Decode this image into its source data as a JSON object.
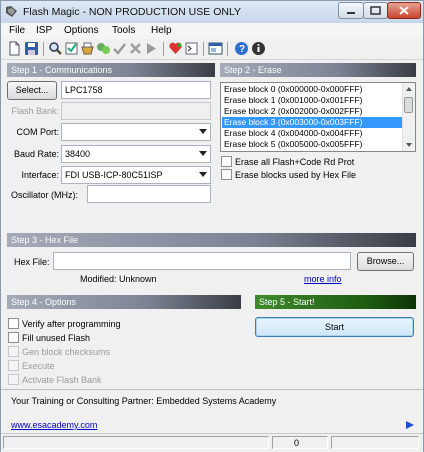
{
  "window": {
    "title": "Flash Magic - NON PRODUCTION USE ONLY"
  },
  "menu": [
    "File",
    "ISP",
    "Options",
    "Tools",
    "Help"
  ],
  "toolbar_icons": [
    "new-icon",
    "save-icon",
    "search-icon",
    "verify-icon",
    "program-icon",
    "check-icon",
    "erase-icon",
    "forward-icon",
    "heart-icon",
    "terminal-icon",
    "window-icon",
    "help-icon",
    "info-icon"
  ],
  "step1": {
    "header": "Step 1 - Communications",
    "select_label": "Select...",
    "device": "LPC1758",
    "flash_bank_label": "Flash Bank:",
    "com_port_label": "COM Port:",
    "com_port_value": "",
    "baud_rate_label": "Baud Rate:",
    "baud_rate_value": "38400",
    "interface_label": "Interface:",
    "interface_value": "FDI USB-ICP-80C51ISP",
    "oscillator_label": "Oscillator (MHz):",
    "oscillator_value": ""
  },
  "step2": {
    "header": "Step 2 - Erase",
    "blocks": [
      "Erase block 0 (0x000000-0x000FFF)",
      "Erase block 1 (0x001000-0x001FFF)",
      "Erase block 2 (0x002000-0x002FFF)",
      "Erase block 3 (0x003000-0x003FFF)",
      "Erase block 4 (0x004000-0x004FFF)",
      "Erase block 5 (0x005000-0x005FFF)"
    ],
    "selected_index": 3,
    "erase_all_label": "Erase all Flash+Code Rd Prot",
    "erase_used_label": "Erase blocks used by Hex File"
  },
  "step3": {
    "header": "Step 3 - Hex File",
    "hex_file_label": "Hex File:",
    "hex_file_value": "",
    "browse_label": "Browse...",
    "modified_text": "Modified: Unknown",
    "more_info": "more info"
  },
  "step4": {
    "header": "Step 4 - Options",
    "options": [
      {
        "label": "Verify after programming",
        "enabled": true
      },
      {
        "label": "Fill unused Flash",
        "enabled": true
      },
      {
        "label": "Gen block checksums",
        "enabled": false
      },
      {
        "label": "Execute",
        "enabled": false
      },
      {
        "label": "Activate Flash Bank",
        "enabled": false
      }
    ]
  },
  "step5": {
    "header": "Step 5 - Start!",
    "start_label": "Start"
  },
  "footer": {
    "partner_text": "Your Training or Consulting Partner: Embedded Systems Academy",
    "link": "www.esacademy.com",
    "status_value": "0"
  },
  "colors": {
    "selection": "#3399ff",
    "step5_header": "#1e5c12",
    "link": "#0000cc"
  }
}
